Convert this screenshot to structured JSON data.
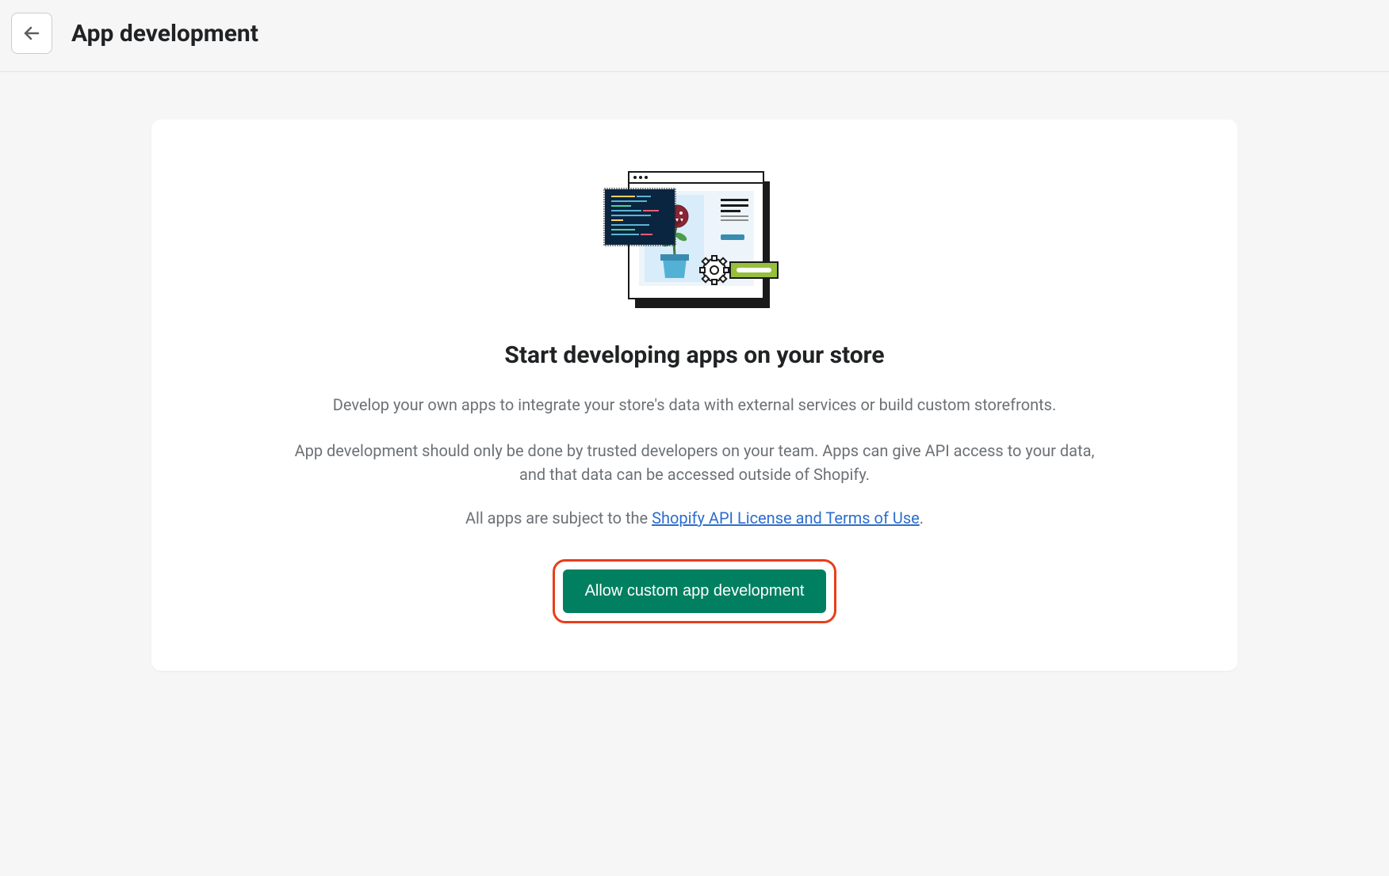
{
  "header": {
    "title": "App development"
  },
  "card": {
    "heading": "Start developing apps on your store",
    "description1": "Develop your own apps to integrate your store's data with external services or build custom storefronts.",
    "description2": "App development should only be done by trusted developers on your team. Apps can give API access to your data, and that data can be accessed outside of Shopify.",
    "terms_prefix": "All apps are subject to the ",
    "terms_link": "Shopify API License and Terms of Use",
    "terms_suffix": ".",
    "cta_label": "Allow custom app development"
  }
}
